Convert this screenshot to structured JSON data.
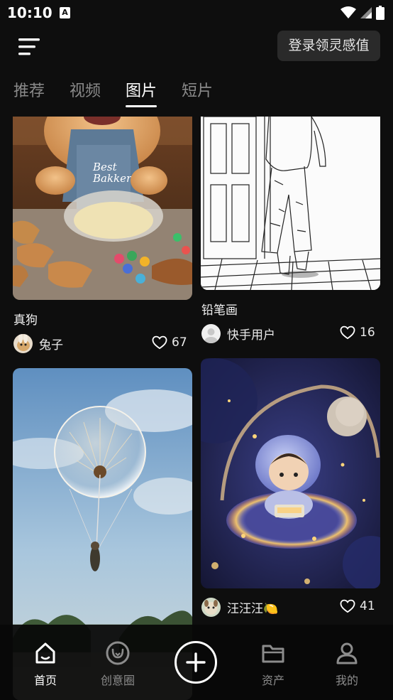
{
  "status_bar": {
    "time": "10:10",
    "notif_glyph": "A"
  },
  "header": {
    "login_button": "登录领灵感值"
  },
  "tabs": [
    "推荐",
    "视频",
    "图片",
    "短片"
  ],
  "active_tab": "图片",
  "feed": {
    "cards": [
      {
        "title": "真狗",
        "author": "兔子",
        "likes": "67",
        "image_text": "Best\nBakker"
      },
      {
        "title": "铅笔画",
        "author": "快手用户",
        "likes": "16"
      },
      {
        "title": "",
        "author": "",
        "likes": ""
      },
      {
        "title": "",
        "author": "汪汪汪🍋",
        "likes": "41"
      }
    ]
  },
  "bottom_nav": {
    "home": "首页",
    "circle": "创意圈",
    "assets": "资产",
    "mine": "我的"
  },
  "colors": {
    "background": "#0e0e0e",
    "accent": "#ffffff",
    "muted": "#8a8a8a"
  },
  "icons": [
    "menu-icon",
    "heart-icon",
    "home-icon",
    "creative-circle-icon",
    "plus-icon",
    "folder-icon",
    "user-icon"
  ]
}
